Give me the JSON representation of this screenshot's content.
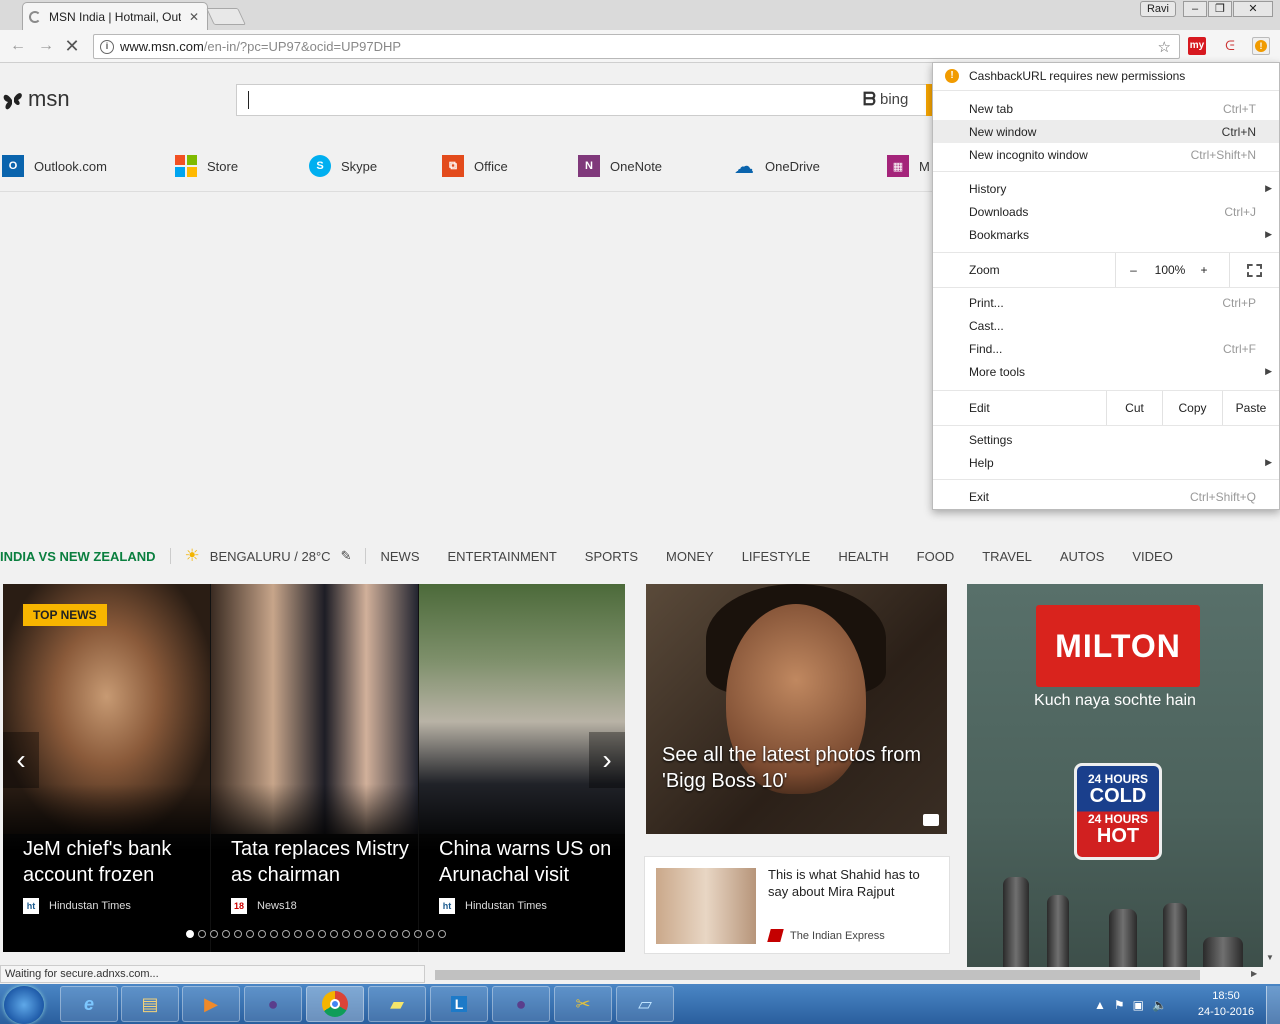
{
  "browser": {
    "tab_title": "MSN India | Hotmail, Out",
    "profile": "Ravi",
    "url_host": "www.msn.com",
    "url_path": "/en-in/?pc=UP97&ocid=UP97DHP",
    "status_text": "Waiting for secure.adnxs.com..."
  },
  "msn": {
    "logo_text": "msn",
    "search_brand": "bing",
    "quicklinks": [
      "Outlook.com",
      "Store",
      "Skype",
      "Office",
      "OneNote",
      "OneDrive",
      "M"
    ]
  },
  "nav": {
    "highlight": "INDIA VS NEW ZEALAND",
    "weather": "BENGALURU / 28°C",
    "items": [
      "NEWS",
      "ENTERTAINMENT",
      "SPORTS",
      "MONEY",
      "LIFESTYLE",
      "HEALTH",
      "FOOD",
      "TRAVEL",
      "AUTOS",
      "VIDEO"
    ]
  },
  "carousel": {
    "badge": "TOP NEWS",
    "slides": [
      {
        "headline": "JeM chief's bank account frozen",
        "source": "Hindustan Times",
        "source_icon": "ht"
      },
      {
        "headline": "Tata replaces Mistry as chairman",
        "source": "News18",
        "source_icon": "18"
      },
      {
        "headline": "China warns US on Arunachal visit",
        "source": "Hindustan Times",
        "source_icon": "ht"
      }
    ],
    "dot_count": 22,
    "active_dot": 0
  },
  "cards": {
    "bigg_boss": "See all the latest photos from 'Bigg Boss 10'",
    "shahid_title": "This is what Shahid has to say about Mira Rajput",
    "shahid_source": "The Indian Express"
  },
  "ad": {
    "brand": "MILTON",
    "tagline": "Kuch naya sochte hain",
    "badge_top": "24 HOURS",
    "badge_cold": "COLD",
    "badge_mid": "24 HOURS",
    "badge_hot": "HOT"
  },
  "menu": {
    "warning": "CashbackURL requires new permissions",
    "new_tab": "New tab",
    "new_tab_sc": "Ctrl+T",
    "new_window": "New window",
    "new_window_sc": "Ctrl+N",
    "incognito": "New incognito window",
    "incognito_sc": "Ctrl+Shift+N",
    "history": "History",
    "downloads": "Downloads",
    "downloads_sc": "Ctrl+J",
    "bookmarks": "Bookmarks",
    "zoom": "Zoom",
    "zoom_minus": "–",
    "zoom_value": "100%",
    "zoom_plus": "+",
    "print": "Print...",
    "print_sc": "Ctrl+P",
    "cast": "Cast...",
    "find": "Find...",
    "find_sc": "Ctrl+F",
    "more_tools": "More tools",
    "edit": "Edit",
    "cut": "Cut",
    "copy": "Copy",
    "paste": "Paste",
    "settings": "Settings",
    "help": "Help",
    "exit": "Exit",
    "exit_sc": "Ctrl+Shift+Q"
  },
  "taskbar": {
    "time": "18:50",
    "date": "24-10-2016"
  },
  "colors": {
    "menu_highlight": "#ececec",
    "msn_orange": "#f4a300",
    "nav_green": "#0a7f3f",
    "topnews_yellow": "#f7b500",
    "milton_red": "#d9231d"
  }
}
